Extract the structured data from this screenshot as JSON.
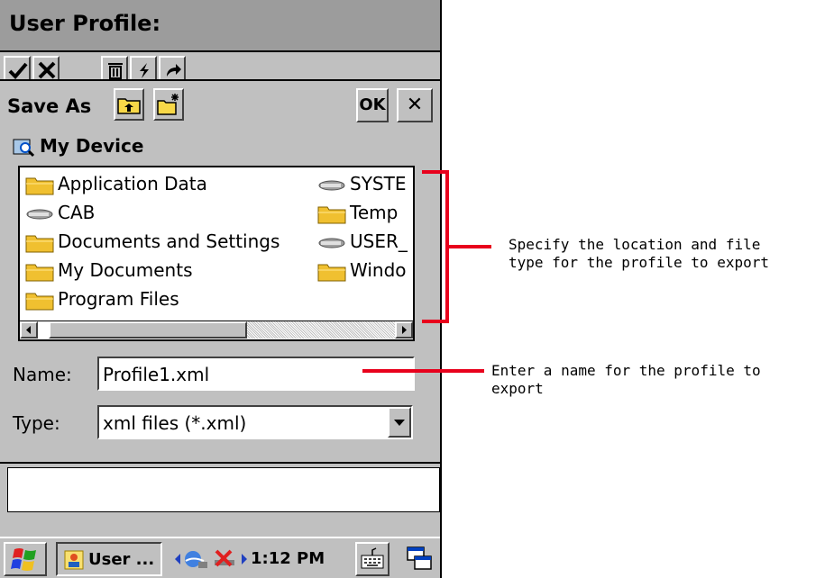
{
  "window": {
    "title": "User Profile:"
  },
  "dialog": {
    "title": "Save As",
    "ok_label": "OK",
    "close_label": "✕",
    "location": "My Device",
    "files": [
      {
        "label": "Application Data",
        "icon": "folder-icon"
      },
      {
        "label": "CAB",
        "icon": "drive-icon"
      },
      {
        "label": "Documents and Settings",
        "icon": "folder-icon"
      },
      {
        "label": "My Documents",
        "icon": "folder-icon"
      },
      {
        "label": "Program Files",
        "icon": "folder-icon"
      },
      {
        "label": "SYSTE",
        "icon": "drive-icon"
      },
      {
        "label": "Temp",
        "icon": "folder-icon"
      },
      {
        "label": "USER_",
        "icon": "drive-icon"
      },
      {
        "label": "Windo",
        "icon": "folder-icon"
      }
    ],
    "name_label": "Name:",
    "name_value": "Profile1.xml",
    "type_label": "Type:",
    "type_value": "xml files (*.xml)"
  },
  "taskbar": {
    "app_label": "User ...",
    "clock": "1:12 PM"
  },
  "annotations": {
    "location_line1": "Specify the location and file",
    "location_line2": "type for the profile to export",
    "name_line1": "Enter a name for the profile to",
    "name_line2": "export"
  },
  "colors": {
    "annotation_red": "#e8001c",
    "chrome_gray": "#c0c0c0",
    "title_gray": "#9c9c9c"
  }
}
